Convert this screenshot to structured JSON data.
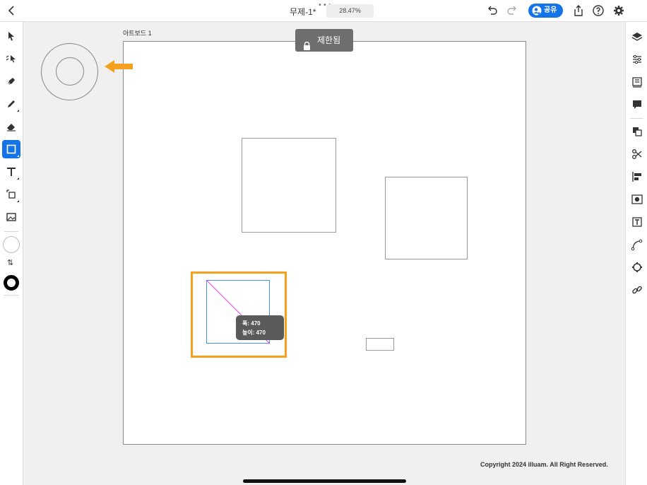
{
  "topbar": {
    "title": "무제-1*",
    "more_dots": "•••",
    "zoom": "28.47%",
    "share_label": "공유"
  },
  "left_toolbar": {
    "tools": [
      "selection-tool",
      "direct-selection-tool",
      "pen-tool",
      "pencil-tool",
      "eraser-tool",
      "rectangle-tool",
      "text-tool",
      "transform-tool",
      "image-tool"
    ],
    "active_tool": "rectangle-tool",
    "fill_color": "#ffffff",
    "stroke_color": "#000000",
    "swap_glyph": "⇅"
  },
  "right_toolbar": {
    "icons": [
      "layers-icon",
      "properties-icon",
      "libraries-icon",
      "comments-icon",
      "arrange-icon",
      "cut-icon",
      "align-icon",
      "pathfinder-icon",
      "type-icon",
      "path-icon",
      "settings-gear-icon",
      "link-icon"
    ]
  },
  "canvas": {
    "artboard_label": "아트보드 1",
    "restricted_label": "제한됨",
    "tooltip_width": "폭: 470",
    "tooltip_height": "높이: 470",
    "copyright": "Copyright 2024 illuam. All Right Reserved.",
    "highlight_color": "#f5a020",
    "accent_color": "#1473e6"
  }
}
